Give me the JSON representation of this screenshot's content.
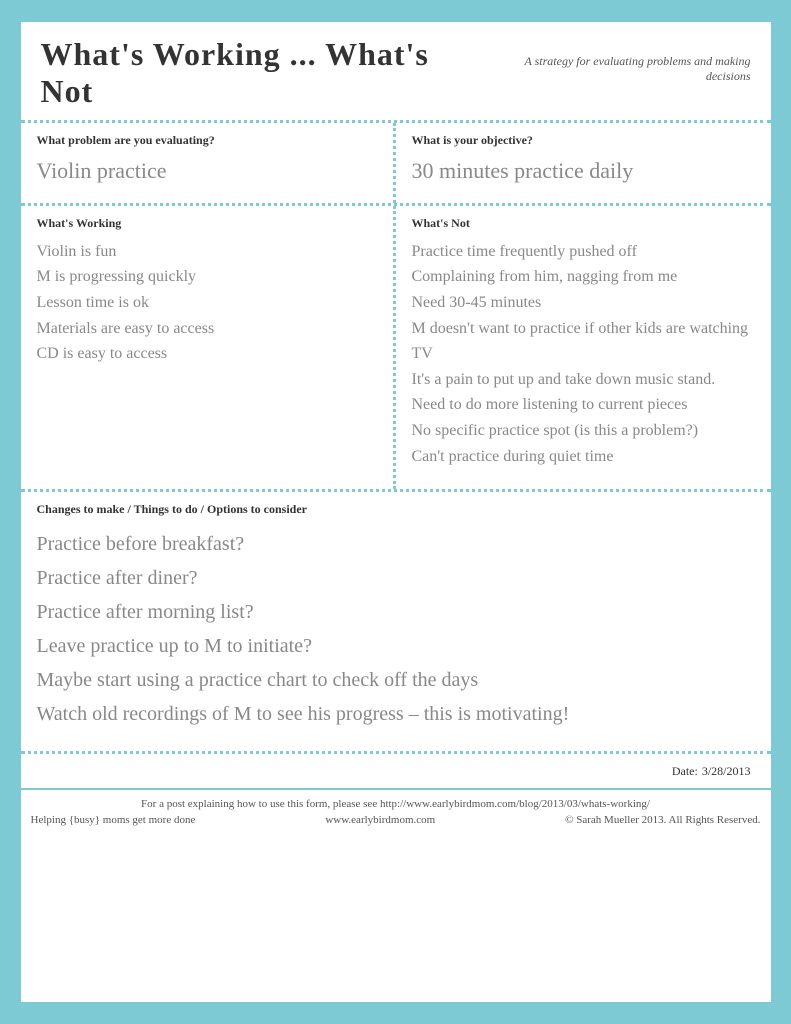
{
  "header": {
    "title": "What's Working ... What's Not",
    "subtitle": "A strategy for evaluating problems and making decisions"
  },
  "problem_section": {
    "left_label": "What problem are you evaluating?",
    "right_label": "What is your objective?",
    "left_value": "Violin practice",
    "right_value": "30 minutes practice daily"
  },
  "working_section": {
    "working_label": "What's Working",
    "not_label": "What's Not",
    "working_items": [
      "Violin is fun",
      "M is progressing quickly",
      "Lesson time is ok",
      "Materials are easy to access",
      "CD is easy to access"
    ],
    "not_items": [
      "Practice time frequently pushed off",
      "Complaining from him, nagging from me",
      "Need 30-45 minutes",
      "M doesn't want to practice if other kids are watching TV",
      "It's a pain to put up and take down music stand.",
      "Need to do more listening to current pieces",
      "No specific practice spot (is this a problem?)",
      "Can't practice during quiet time"
    ]
  },
  "changes_section": {
    "label": "Changes to make / Things to do / Options to consider",
    "items": [
      "Practice before breakfast?",
      "Practice after diner?",
      "Practice after morning list?",
      "Leave practice up to M to initiate?",
      "Maybe start using a practice chart to check off the days",
      "Watch old recordings of M to see his progress – this is motivating!"
    ]
  },
  "date": {
    "label": "Date:",
    "value": "3/28/2013"
  },
  "footer": {
    "line1": "For a post explaining how to use this form, please see http://www.earlybirdmom.com/blog/2013/03/whats-working/",
    "left": "Helping {busy} moms get more done",
    "center": "www.earlybirdmom.com",
    "right": "© Sarah Mueller 2013. All Rights Reserved."
  }
}
